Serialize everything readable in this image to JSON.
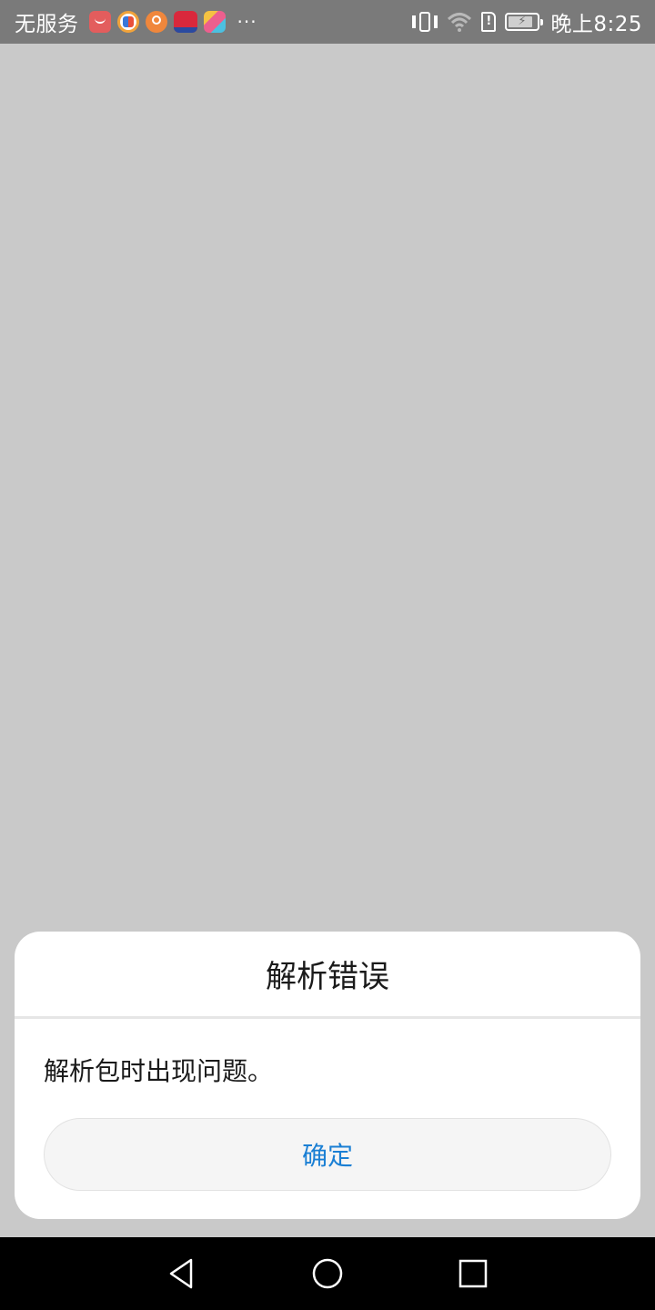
{
  "status_bar": {
    "carrier": "无服务",
    "more": "···",
    "time": "晚上8:25",
    "sim_alert": "!",
    "icons": [
      "huawei-store-icon",
      "weibo-icon",
      "orange-app-icon",
      "red-app-icon",
      "multicolor-app-icon",
      "vibrate-icon",
      "wifi-icon",
      "sim-alert-icon",
      "battery-icon"
    ],
    "battery_level": 0.85
  },
  "dialog": {
    "title": "解析错误",
    "message": "解析包时出现问题。",
    "ok_label": "确定",
    "accent_color": "#1a7fd4"
  },
  "nav_bar": {
    "buttons": [
      "back-icon",
      "home-icon",
      "recent-apps-icon"
    ]
  }
}
